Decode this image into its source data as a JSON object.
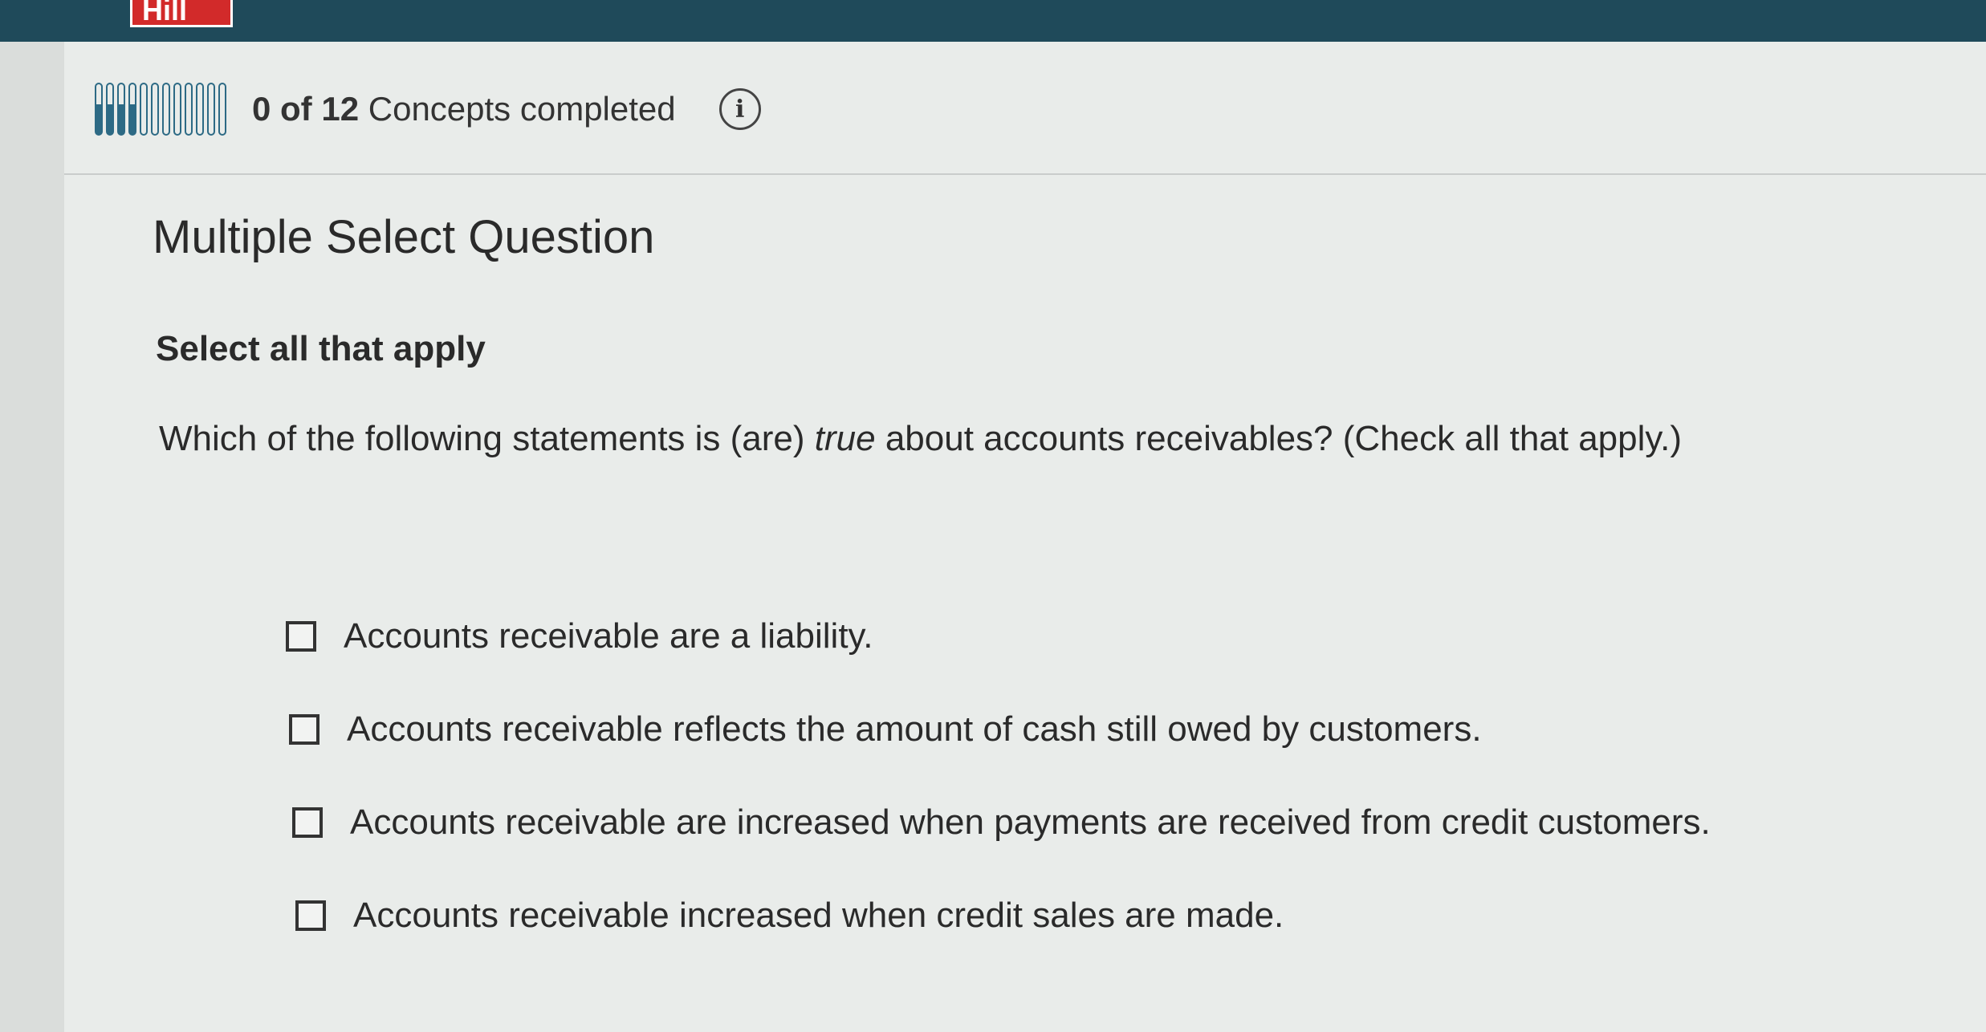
{
  "header": {
    "logo_text": "Hill",
    "colors": {
      "bar": "#1f4a5a",
      "logo": "#d22a2a",
      "progress": "#2d6a85"
    }
  },
  "progress": {
    "completed": "0",
    "of_text": "of",
    "total": "12",
    "suffix": "Concepts completed",
    "info_icon": "info-icon"
  },
  "question": {
    "type_title": "Multiple Select Question",
    "instruction": "Select all that apply",
    "prompt_before": "Which of the following statements is (are) ",
    "prompt_italic": "true",
    "prompt_after": " about accounts receivables? (Check all that apply.)",
    "options": [
      {
        "label": "Accounts receivable are a liability.",
        "checked": false
      },
      {
        "label": "Accounts receivable reflects the amount of cash still owed by customers.",
        "checked": false
      },
      {
        "label": "Accounts receivable are increased when payments are received from credit customers.",
        "checked": false
      },
      {
        "label": "Accounts receivable increased when credit sales are made.",
        "checked": false
      }
    ]
  }
}
